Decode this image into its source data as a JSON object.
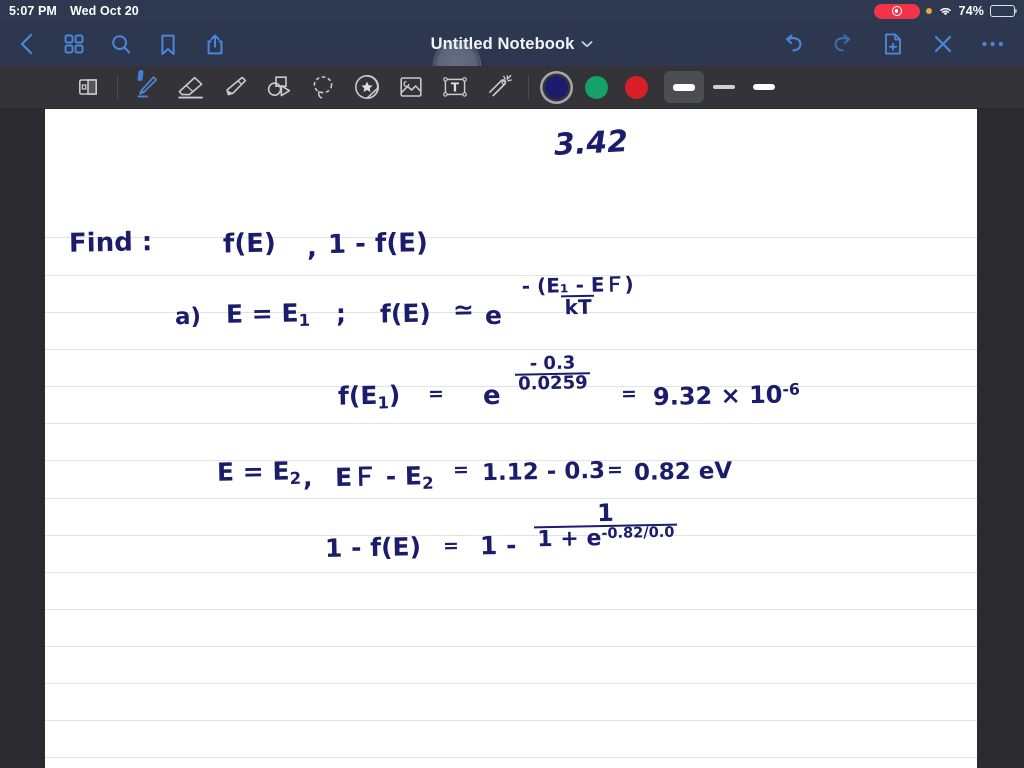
{
  "status_bar": {
    "time": "5:07 PM",
    "date": "Wed Oct 20",
    "battery_percent": "74%",
    "recording_indicator": "record-active",
    "location_indicator": "location-active",
    "wifi_indicator": "wifi-connected",
    "bg_color": "#2e3951"
  },
  "nav_bar": {
    "title": "Untitled Notebook",
    "chevron": "∨",
    "left_items": [
      {
        "name": "back-button",
        "icon": "chevron-left-icon"
      },
      {
        "name": "grid-view-button",
        "icon": "grid-icon"
      },
      {
        "name": "search-button",
        "icon": "search-icon"
      },
      {
        "name": "bookmark-button",
        "icon": "bookmark-icon"
      },
      {
        "name": "share-button",
        "icon": "share-icon"
      }
    ],
    "right_items": [
      {
        "name": "undo-button",
        "icon": "undo-icon"
      },
      {
        "name": "redo-button",
        "icon": "redo-icon"
      },
      {
        "name": "new-page-button",
        "icon": "page-plus-icon"
      },
      {
        "name": "close-button",
        "icon": "close-x-icon"
      },
      {
        "name": "more-options-button",
        "icon": "ellipsis-icon"
      }
    ],
    "bg_color": "#2d3750",
    "accent_color": "#4b86d8"
  },
  "toolbar": {
    "bg_color": "#333338",
    "tools": [
      {
        "name": "page-layout-tool",
        "icon": "page-layout-icon",
        "selected": false
      },
      {
        "name": "pen-tool",
        "icon": "pen-icon",
        "selected": true
      },
      {
        "name": "eraser-tool",
        "icon": "eraser-icon",
        "selected": false
      },
      {
        "name": "highlighter-tool",
        "icon": "highlighter-icon",
        "selected": false
      },
      {
        "name": "shape-tool",
        "icon": "shapes-icon",
        "selected": false
      },
      {
        "name": "lasso-tool",
        "icon": "lasso-icon",
        "selected": false
      },
      {
        "name": "sticker-tool",
        "icon": "sticker-star-icon",
        "selected": false
      },
      {
        "name": "image-tool",
        "icon": "image-icon",
        "selected": false
      },
      {
        "name": "text-box-tool",
        "icon": "text-box-icon",
        "selected": false
      },
      {
        "name": "magic-wand-tool",
        "icon": "magic-wand-icon",
        "selected": false
      }
    ],
    "colors": [
      {
        "name": "color-swatch-navy",
        "hex": "#1b1c6b",
        "selected": true
      },
      {
        "name": "color-swatch-green",
        "hex": "#16a06a",
        "selected": false
      },
      {
        "name": "color-swatch-red",
        "hex": "#d61f26",
        "selected": false
      }
    ],
    "thickness": [
      {
        "name": "thickness-thick",
        "width": 22,
        "height": 7,
        "selected": true
      },
      {
        "name": "thickness-medium",
        "width": 22,
        "height": 4,
        "selected": false
      },
      {
        "name": "thickness-thin",
        "width": 22,
        "height": 6,
        "selected": false
      }
    ]
  },
  "page": {
    "bg_color": "#ffffff",
    "rule_color": "#e3e3e6",
    "ink_color": "#1b1c6b",
    "ruled_line_ys": [
      128,
      166,
      203,
      240,
      277,
      314,
      351,
      389,
      426,
      463,
      500,
      537,
      574,
      611,
      648
    ],
    "notes": {
      "heading": "3.42",
      "line_find_label": "Find :",
      "line_find_expr_1": "f(E)",
      "line_find_comma": ",",
      "line_find_expr_2": "1 - f(E)",
      "part_a_label": "a)",
      "part_a_condition": "E = E",
      "part_a_condition_sub": "1",
      "part_a_semicolon": ";",
      "part_a_fe": "f(E)",
      "part_a_approx": "≃",
      "part_a_e": "e",
      "part_a_exp_num": "- (E₁ - EＦ)",
      "part_a_exp_den": "kT",
      "result_lhs": "f(E",
      "result_lhs_sub": "1",
      "result_lhs_close": ")",
      "result_eq1": "=",
      "result_e": "e",
      "result_exp_num": "- 0.3",
      "result_exp_den": "0.0259",
      "result_eq2": "=",
      "result_value": "9.32 × 10",
      "result_value_sup": "-6",
      "line4_e": "E = E",
      "line4_e_sub": "2",
      "line4_comma": ",",
      "line4_ef": "EＦ - E",
      "line4_ef_sub": "2",
      "line4_eq1": "=",
      "line4_calc": "1.12 - 0.3",
      "line4_eq2": "=",
      "line4_result": "0.82 eV",
      "line5_lhs": "1 - f(E)",
      "line5_eq": "=",
      "line5_one": "1 -",
      "line5_frac_num": "1",
      "line5_frac_den_pre": "1 + e",
      "line5_frac_den_sup": "-0.82/0.0"
    }
  }
}
